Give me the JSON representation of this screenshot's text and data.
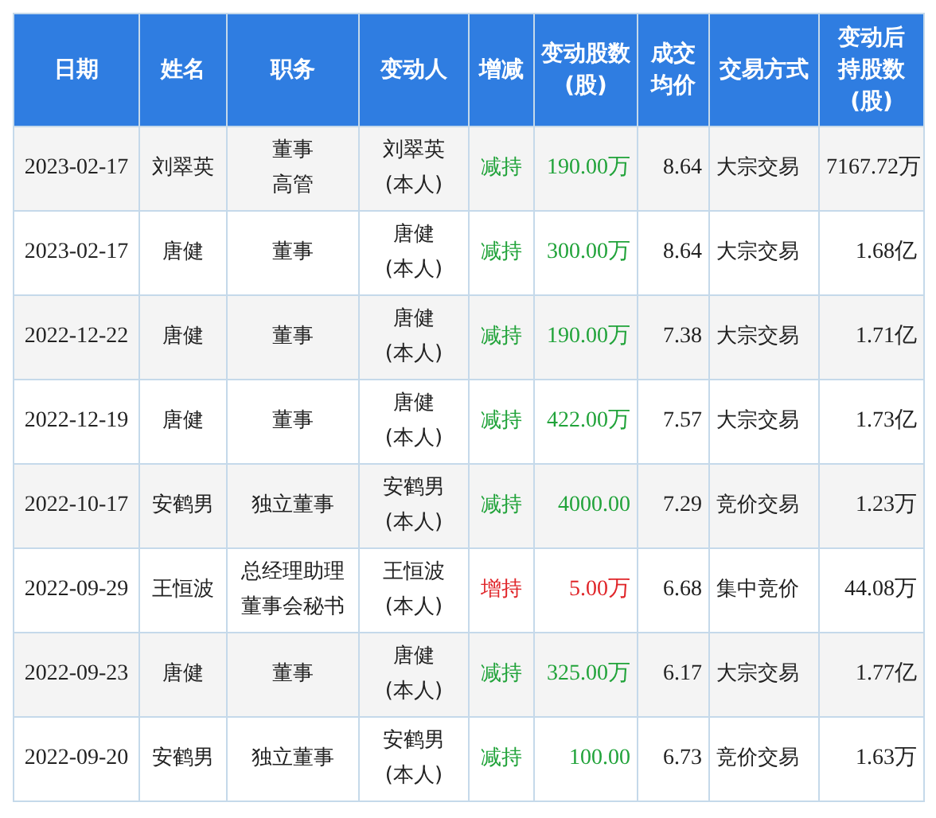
{
  "table": {
    "columns": [
      "日期",
      "姓名",
      "职务",
      "变动人",
      "增减",
      "变动股数(股)",
      "成交均价",
      "交易方式",
      "变动后持股数(股)"
    ],
    "rows": [
      {
        "date": "2023-02-17",
        "name": "刘翠英",
        "positions": [
          "董事",
          "高管"
        ],
        "actor": "刘翠英",
        "actor_note": "(本人)",
        "change": "减持",
        "kind": "decrease",
        "shares": "190.00万",
        "price": "8.64",
        "method": "大宗交易",
        "holding": "7167.72万"
      },
      {
        "date": "2023-02-17",
        "name": "唐健",
        "positions": [
          "董事"
        ],
        "actor": "唐健",
        "actor_note": "(本人)",
        "change": "减持",
        "kind": "decrease",
        "shares": "300.00万",
        "price": "8.64",
        "method": "大宗交易",
        "holding": "1.68亿"
      },
      {
        "date": "2022-12-22",
        "name": "唐健",
        "positions": [
          "董事"
        ],
        "actor": "唐健",
        "actor_note": "(本人)",
        "change": "减持",
        "kind": "decrease",
        "shares": "190.00万",
        "price": "7.38",
        "method": "大宗交易",
        "holding": "1.71亿"
      },
      {
        "date": "2022-12-19",
        "name": "唐健",
        "positions": [
          "董事"
        ],
        "actor": "唐健",
        "actor_note": "(本人)",
        "change": "减持",
        "kind": "decrease",
        "shares": "422.00万",
        "price": "7.57",
        "method": "大宗交易",
        "holding": "1.73亿"
      },
      {
        "date": "2022-10-17",
        "name": "安鹤男",
        "positions": [
          "独立董事"
        ],
        "actor": "安鹤男",
        "actor_note": "(本人)",
        "change": "减持",
        "kind": "decrease",
        "shares": "4000.00",
        "price": "7.29",
        "method": "竞价交易",
        "holding": "1.23万"
      },
      {
        "date": "2022-09-29",
        "name": "王恒波",
        "positions": [
          "总经理助理",
          "董事会秘书"
        ],
        "actor": "王恒波",
        "actor_note": "(本人)",
        "change": "增持",
        "kind": "increase",
        "shares": "5.00万",
        "price": "6.68",
        "method": "集中竞价",
        "holding": "44.08万"
      },
      {
        "date": "2022-09-23",
        "name": "唐健",
        "positions": [
          "董事"
        ],
        "actor": "唐健",
        "actor_note": "(本人)",
        "change": "减持",
        "kind": "decrease",
        "shares": "325.00万",
        "price": "6.17",
        "method": "大宗交易",
        "holding": "1.77亿"
      },
      {
        "date": "2022-09-20",
        "name": "安鹤男",
        "positions": [
          "独立董事"
        ],
        "actor": "安鹤男",
        "actor_note": "(本人)",
        "change": "减持",
        "kind": "decrease",
        "shares": "100.00",
        "price": "6.73",
        "method": "竞价交易",
        "holding": "1.63万"
      }
    ]
  }
}
